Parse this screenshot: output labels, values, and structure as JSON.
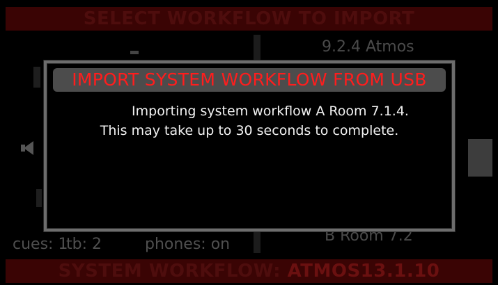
{
  "background": {
    "header_title": "SELECT WORKFLOW TO IMPORT",
    "item_top_right": "9.2.4 Atmos",
    "item_bottom_right": "B Room 7.2",
    "status": {
      "cues": "cues: 1",
      "tb": "tb: 2",
      "phones": "phones: on"
    },
    "footer_label": "SYSTEM WORKFLOW:",
    "footer_value": "ATMOS13.1.10"
  },
  "modal": {
    "title": "IMPORT SYSTEM WORKFLOW FROM USB",
    "line1": "Importing system workflow A Room 7.1.4.",
    "line2": "This may take up to 30 seconds to complete."
  },
  "colors": {
    "title_red": "#ff1d1d",
    "bar_dark_red": "#3a0404",
    "modal_border": "#6d6d6d"
  }
}
